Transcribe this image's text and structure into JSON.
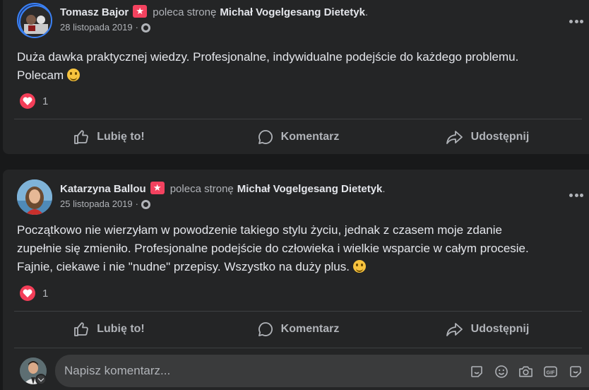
{
  "posts": [
    {
      "author": "Tomasz Bajor",
      "recommends_text": "poleca stronę",
      "page_name": "Michał Vogelgesang Dietetyk",
      "period": ".",
      "date": "28 listopada 2019",
      "date_sep": "·",
      "text_line1": "Duża dawka praktycznej wiedzy. Profesjonalne, indywidualne podejście do każdego problemu.",
      "text_line2": "Polecam",
      "reaction_count": "1"
    },
    {
      "author": "Katarzyna Ballou",
      "recommends_text": "poleca stronę",
      "page_name": "Michał Vogelgesang Dietetyk",
      "period": ".",
      "date": "25 listopada 2019",
      "date_sep": "·",
      "text_line1": "Początkowo nie wierzyłam w powodzenie takiego stylu życiu, jednak z czasem moje zdanie",
      "text_line2": "zupełnie się zmieniło. Profesjonalne podejście do człowieka i wielkie wsparcie w całym procesie.",
      "text_line3": "Fajnie, ciekawe i nie \"nudne\" przepisy. Wszystko na duży plus.",
      "reaction_count": "1"
    }
  ],
  "actions": {
    "like": "Lubię to!",
    "comment": "Komentarz",
    "share": "Udostępnij"
  },
  "comment_box": {
    "placeholder": "Napisz komentarz..."
  },
  "colors": {
    "background": "#18191a",
    "card": "#242526",
    "recommend_icon": "#f3425f",
    "heart": "#f33e58"
  }
}
